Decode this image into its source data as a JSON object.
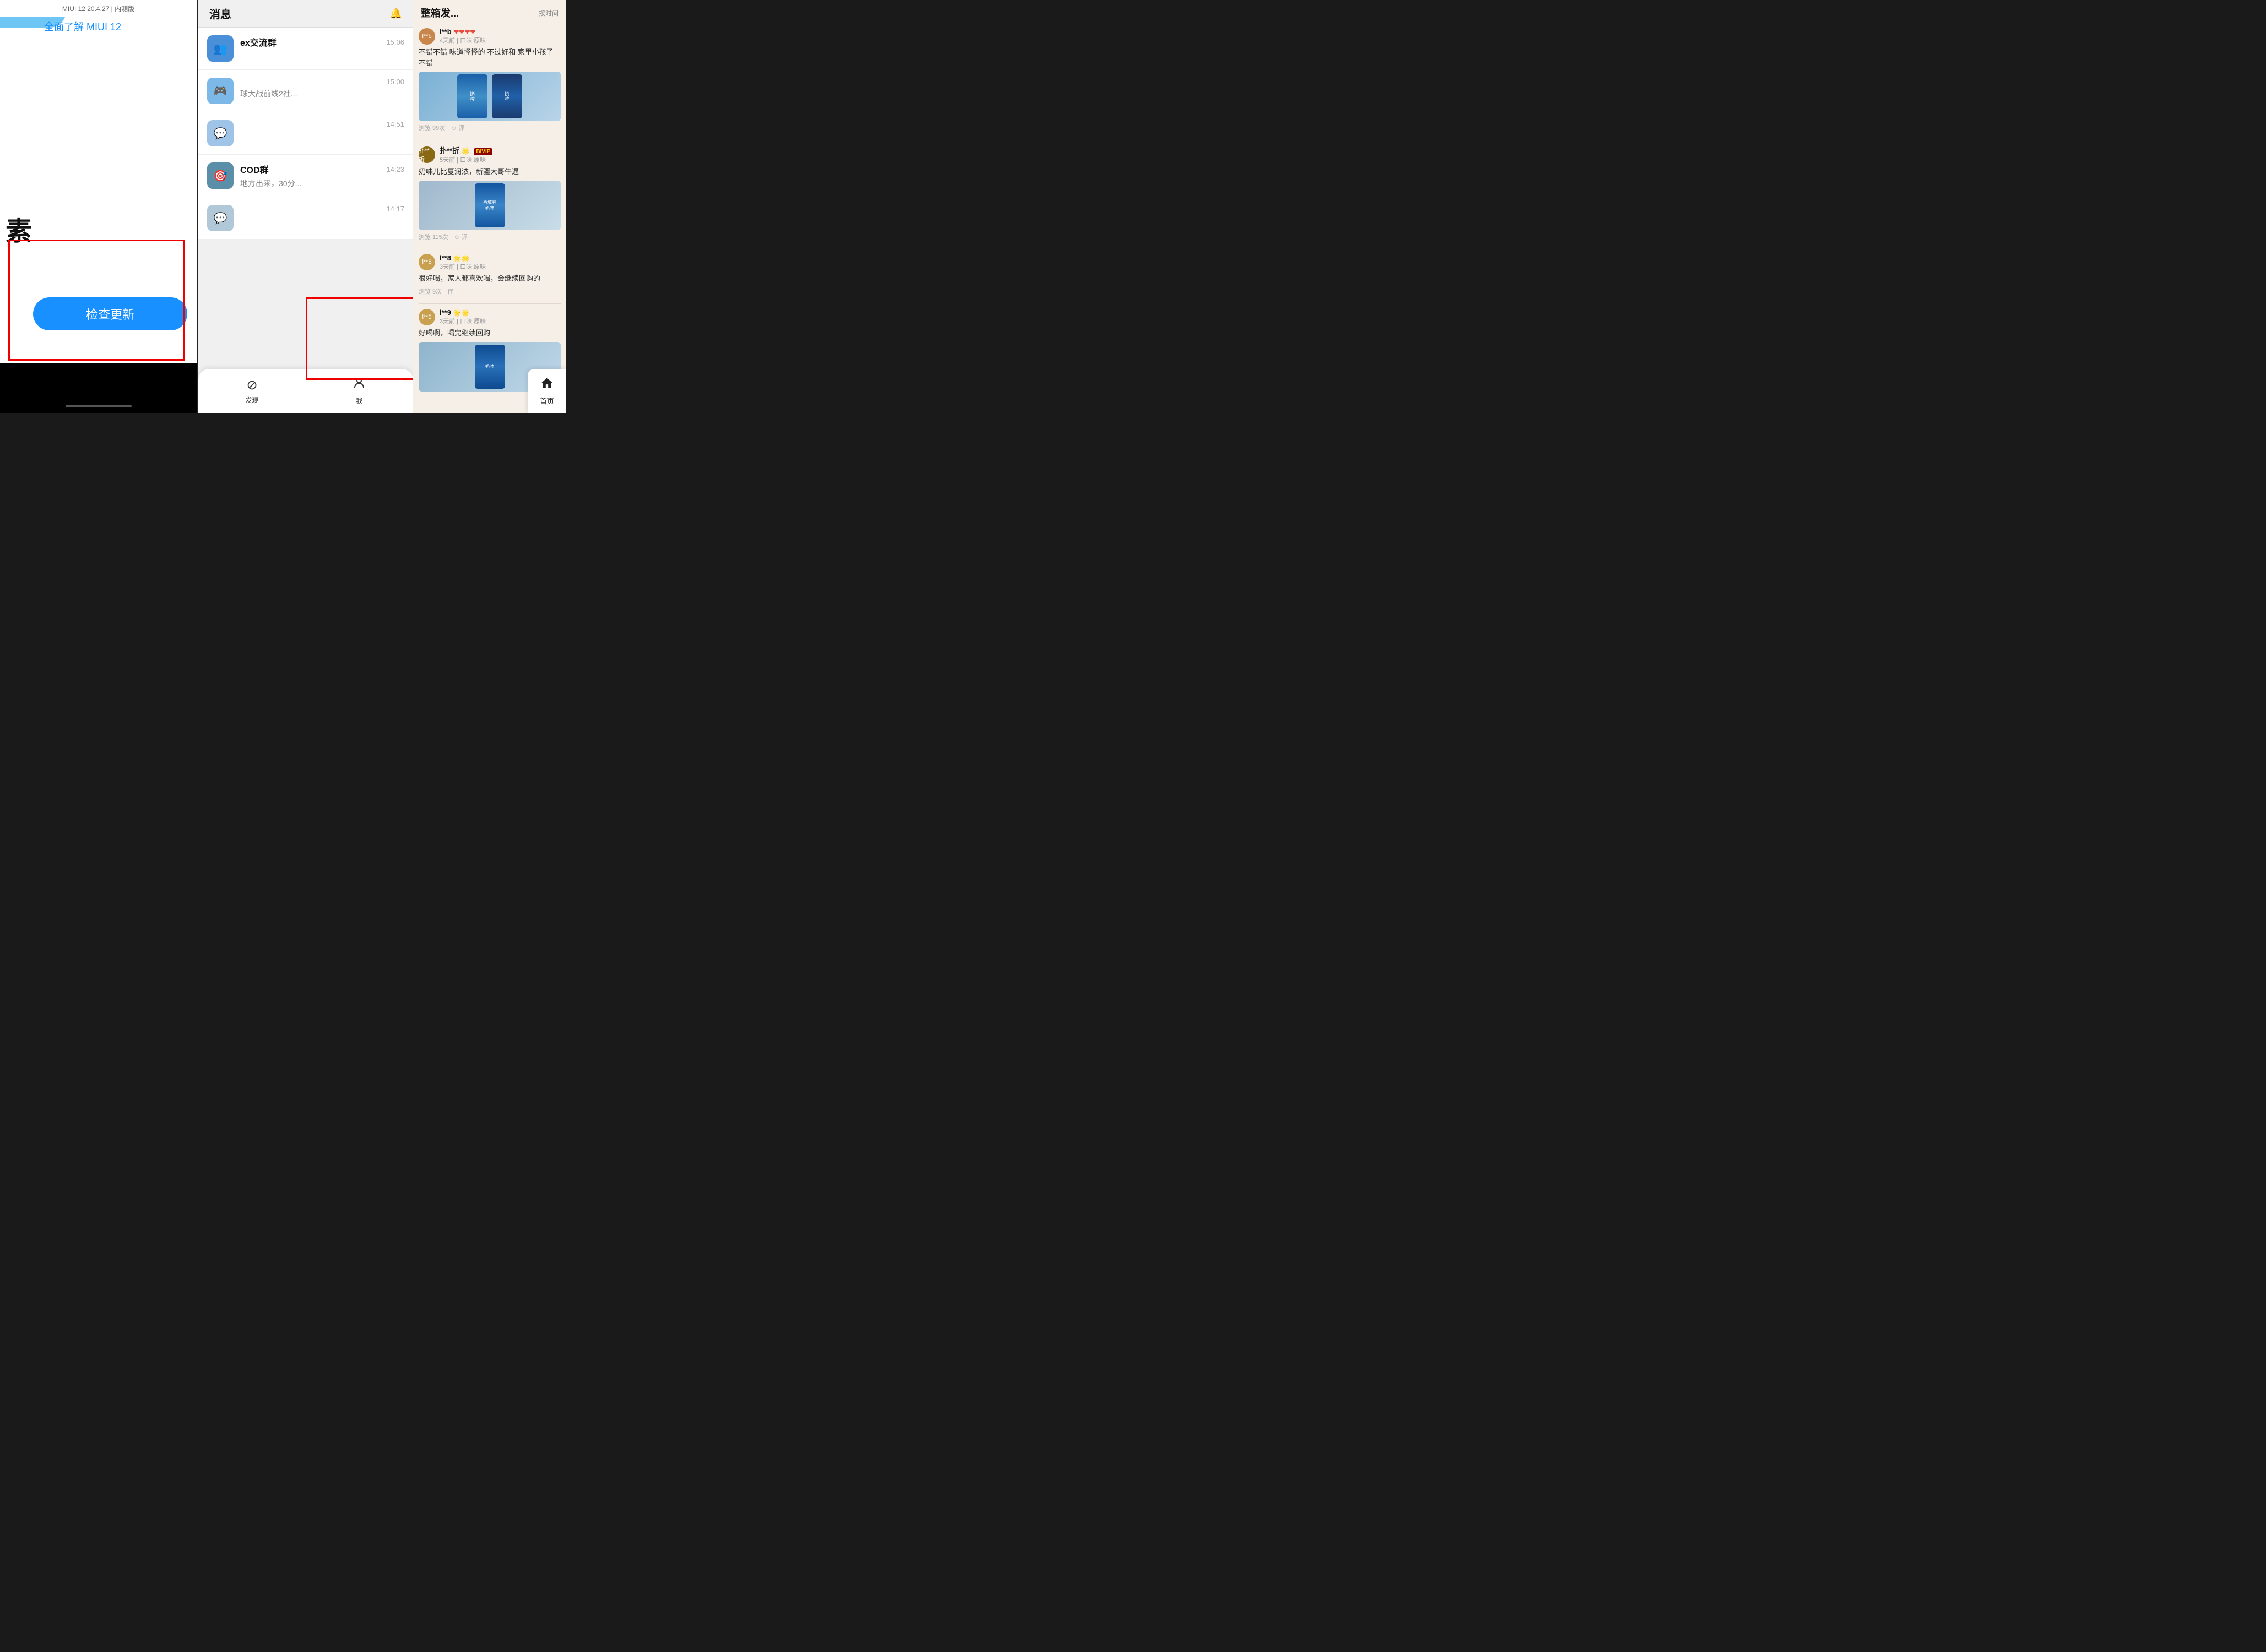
{
  "left_panel": {
    "miui_header": "MIUI 12 20.4.27 | 内测版",
    "miui_link": "全面了解 MIUI 12",
    "su_char": "素",
    "check_update_btn": "检查更新"
  },
  "middle_panel": {
    "chat_list": [
      {
        "id": 1,
        "name": "ex交流群",
        "time": "15:06",
        "preview": "",
        "avatar_emoji": "👥",
        "avatar_bg": "#4a90d9"
      },
      {
        "id": 2,
        "name": "",
        "time": "15:00",
        "preview": "球大战前线2社...",
        "avatar_emoji": "🎮",
        "avatar_bg": "#7cb9e8"
      },
      {
        "id": 3,
        "name": "",
        "time": "14:51",
        "preview": "",
        "avatar_emoji": "💬",
        "avatar_bg": "#a0c4e8"
      },
      {
        "id": 4,
        "name": "COD群",
        "time": "14:23",
        "preview": "地方出来，30分...",
        "avatar_emoji": "🎯",
        "avatar_bg": "#5b8fa8"
      },
      {
        "id": 5,
        "name": "",
        "time": "14:17",
        "preview": "",
        "avatar_emoji": "💬",
        "avatar_bg": "#b0c8d8"
      }
    ],
    "nav": {
      "discover": "发现",
      "me": "我",
      "home": "首页"
    }
  },
  "right_panel": {
    "title": "整箱发...",
    "subtitle": "按时间",
    "reviews": [
      {
        "id": 1,
        "name": "l**b ❤❤❤❤",
        "meta": "4天前 | 口味:原味",
        "badge": null,
        "text": "不错不错 味道怪怪的 不过好和 家里小孩子 不错",
        "has_image": true,
        "image_type": "milk_can_1",
        "stats": [
          "浏览 99次",
          "评论"
        ]
      },
      {
        "id": 2,
        "name": "扑**折 🌟 BIVIP",
        "meta": "5天前 | 口味:原味",
        "badge": "BIVIP",
        "text": "奶味儿比夏润浓，新疆大哥牛逼",
        "has_image": true,
        "image_type": "milk_can_2",
        "stats": [
          "浏览 115次",
          "评论"
        ]
      },
      {
        "id": 3,
        "name": "l**8 🌟🌟",
        "meta": "3天前 | 口味:原味",
        "badge": null,
        "text": "很好喝，家人都喜欢喝，会继续回购的",
        "has_image": false,
        "stats": [
          "浏览 9次",
          "伴"
        ]
      },
      {
        "id": 4,
        "name": "l**9 🌟🌟",
        "meta": "3天前 | 口味:原味",
        "badge": null,
        "text": "好喝啊，喝完继续回购",
        "has_image": true,
        "image_type": "milk_can_3",
        "stats": []
      }
    ]
  }
}
